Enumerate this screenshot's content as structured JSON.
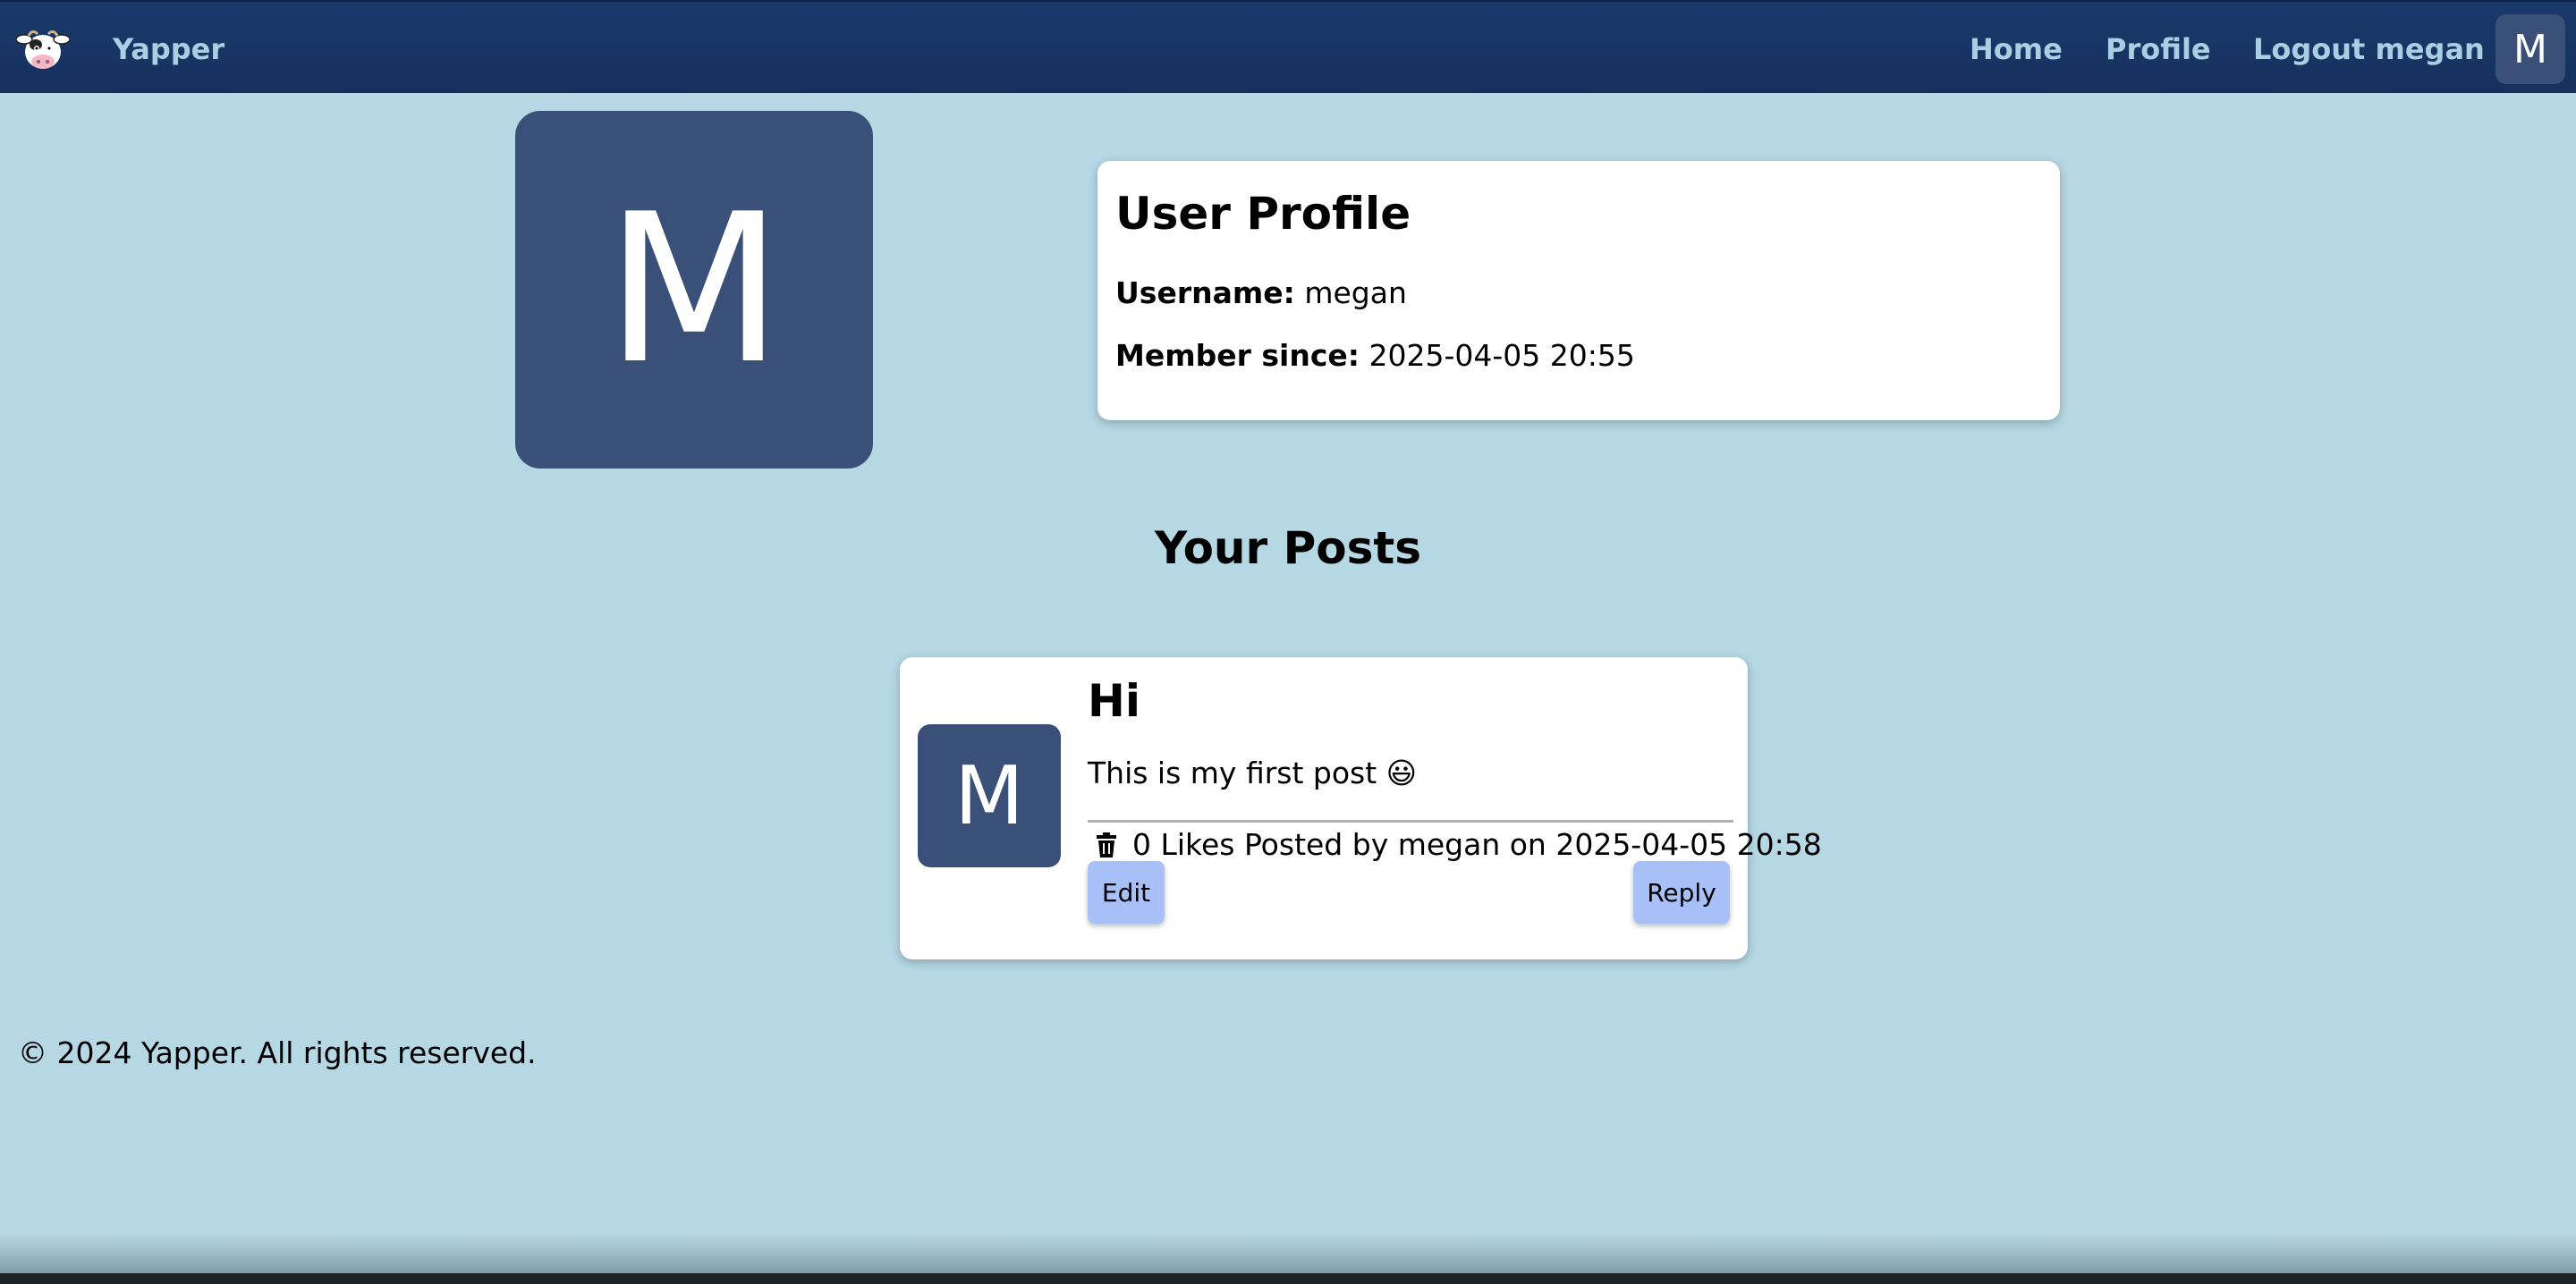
{
  "navbar": {
    "brand": "Yapper",
    "links": [
      "Home",
      "Profile",
      "Logout megan"
    ],
    "avatar_letter": "M"
  },
  "profile": {
    "avatar_letter": "M",
    "title": "User Profile",
    "username_label": "Username:",
    "username": "megan",
    "member_since_label": "Member since:",
    "member_since": "2025-04-05 20:55"
  },
  "posts_heading": "Your Posts",
  "posts": [
    {
      "avatar_letter": "M",
      "title": "Hi",
      "body": "This is my first post 😃",
      "meta": "0 Likes Posted by megan on 2025-04-05 20:58",
      "edit_label": "Edit",
      "reply_label": "Reply"
    }
  ],
  "footer": "© 2024 Yapper. All rights reserved.",
  "colors": {
    "navbar_bg": "#1a3a6b",
    "page_bg": "#b5d8e4",
    "avatar_bg": "#3b5078",
    "button_bg": "#a7c0f7",
    "nav_text": "#a9cfe3"
  }
}
